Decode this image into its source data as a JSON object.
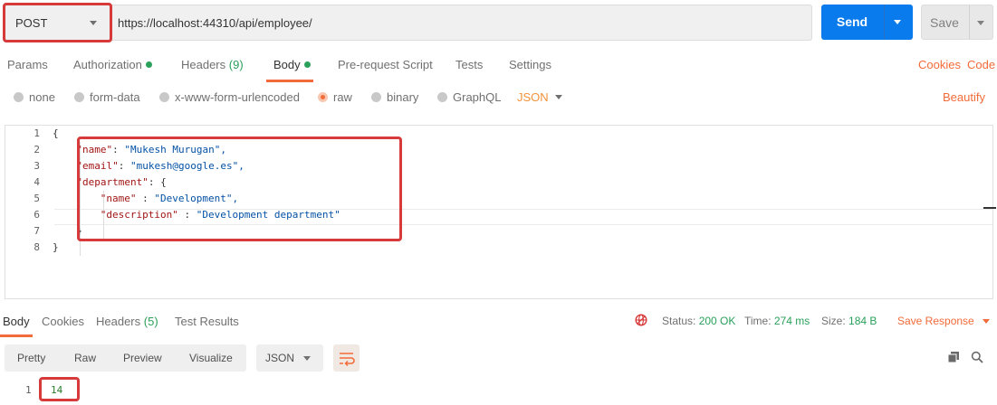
{
  "request": {
    "method": "POST",
    "url": "https://localhost:44310/api/employee/",
    "send_label": "Send",
    "save_label": "Save"
  },
  "request_tabs": {
    "params": "Params",
    "authorization": "Authorization",
    "headers": "Headers",
    "headers_count": "(9)",
    "body": "Body",
    "prerequest": "Pre-request Script",
    "tests": "Tests",
    "settings": "Settings",
    "cookies": "Cookies",
    "code": "Code"
  },
  "body_types": {
    "none": "none",
    "form_data": "form-data",
    "urlencoded": "x-www-form-urlencoded",
    "raw": "raw",
    "binary": "binary",
    "graphql": "GraphQL",
    "format": "JSON",
    "beautify": "Beautify",
    "selected": "raw"
  },
  "editor": {
    "line_numbers": [
      "1",
      "2",
      "3",
      "4",
      "5",
      "6",
      "7",
      "8"
    ],
    "lines": [
      {
        "indent": "",
        "key": "",
        "sep": "",
        "value": "{"
      },
      {
        "indent": "    ",
        "key": "\"name\"",
        "sep": ": ",
        "value": "\"Mukesh Murugan\","
      },
      {
        "indent": "    ",
        "key": "\"email\"",
        "sep": ": ",
        "value": "\"mukesh@google.es\","
      },
      {
        "indent": "    ",
        "key": "\"department\"",
        "sep": ": ",
        "value": "{"
      },
      {
        "indent": "        ",
        "key": "\"name\"",
        "sep": " : ",
        "value": "\"Development\","
      },
      {
        "indent": "        ",
        "key": "\"description\"",
        "sep": " : ",
        "value": "\"Development department\""
      },
      {
        "indent": "    ",
        "key": "",
        "sep": "",
        "value": "}"
      },
      {
        "indent": "",
        "key": "",
        "sep": "",
        "value": "}"
      }
    ]
  },
  "response_tabs": {
    "body": "Body",
    "cookies": "Cookies",
    "headers": "Headers",
    "headers_count": "(5)",
    "test_results": "Test Results"
  },
  "response_status": {
    "status_label": "Status:",
    "status_value": "200 OK",
    "time_label": "Time:",
    "time_value": "274 ms",
    "size_label": "Size:",
    "size_value": "184 B",
    "save_response": "Save Response"
  },
  "response_view": {
    "pretty": "Pretty",
    "raw": "Raw",
    "preview": "Preview",
    "visualize": "Visualize",
    "format": "JSON"
  },
  "response_body": {
    "line_number": "1",
    "value": "14"
  },
  "colors": {
    "accent": "#f26b3a",
    "send": "#097bed",
    "success": "#2aa05a",
    "highlight": "#d63a3a"
  }
}
